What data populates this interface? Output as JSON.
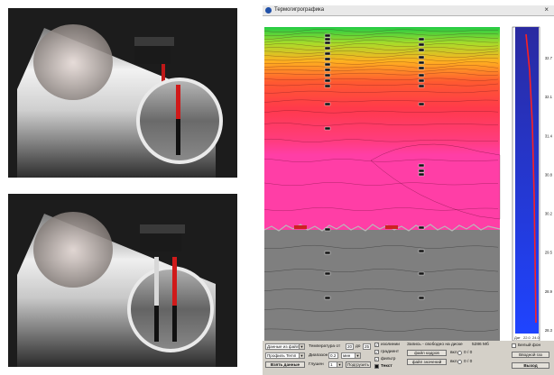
{
  "window": {
    "title": "Термогигрографика",
    "close_glyph": "×"
  },
  "chart_data": {
    "type": "heatmap",
    "x_ticks": [
      "23:07:17",
      "23:07:50",
      "23:08:23",
      "23:08:56",
      "23:09:29",
      "23:10:02",
      "23:10:35",
      "23:11:08",
      "23:11:42"
    ],
    "x_footer": "13.12.2017 23:11:42",
    "right_axis_ticks": [
      "32.7",
      "32.1",
      "31.4",
      "30.8",
      "30.2",
      "29.5",
      "28.9",
      "28.3"
    ],
    "side_scale_ticks": [
      "64",
      "59",
      "54",
      "48",
      "43",
      "38",
      "32",
      "27",
      "22",
      "16",
      "11",
      "6"
    ],
    "side_footer": [
      "Дат",
      "22.0",
      "24.0"
    ],
    "colors": {
      "top": "#22cc44",
      "mid": "#ff3a4a",
      "warm": "#ff3ea0",
      "liquid": "#7f7f7f",
      "interface": "#cc2222"
    }
  },
  "controls": {
    "mode_select": "Данные из файл.",
    "profile_select": "Профиль Temп",
    "load_button": "Взять данные",
    "temp_label": "Температура от",
    "temp_from": "20",
    "temp_to_label": "до",
    "temp_to": "25",
    "range_label": "Диапазон",
    "range_value": "0.2",
    "range_unit": "мин",
    "smooth_label": "Глушен",
    "smooth_value": "1",
    "show_button": "Подгрузить",
    "chk_isolines": "изолинии",
    "chk_gradient": "градиент",
    "chk_filter": "фильтр",
    "chk_text": "Текст",
    "record_label": "Запись - свободно на диске",
    "free_space": "5286 Мб",
    "btn_file_cells": "файл кадров",
    "btn_file_values": "файл значений",
    "rec_label_1": "вкл",
    "rec_count_1": "0 / 0",
    "rec_label_2": "вкл",
    "rec_count_2": "0 / 0",
    "white_bg": "Белый фон",
    "water_input": "Вводной газ",
    "exit_button": "Выход"
  }
}
